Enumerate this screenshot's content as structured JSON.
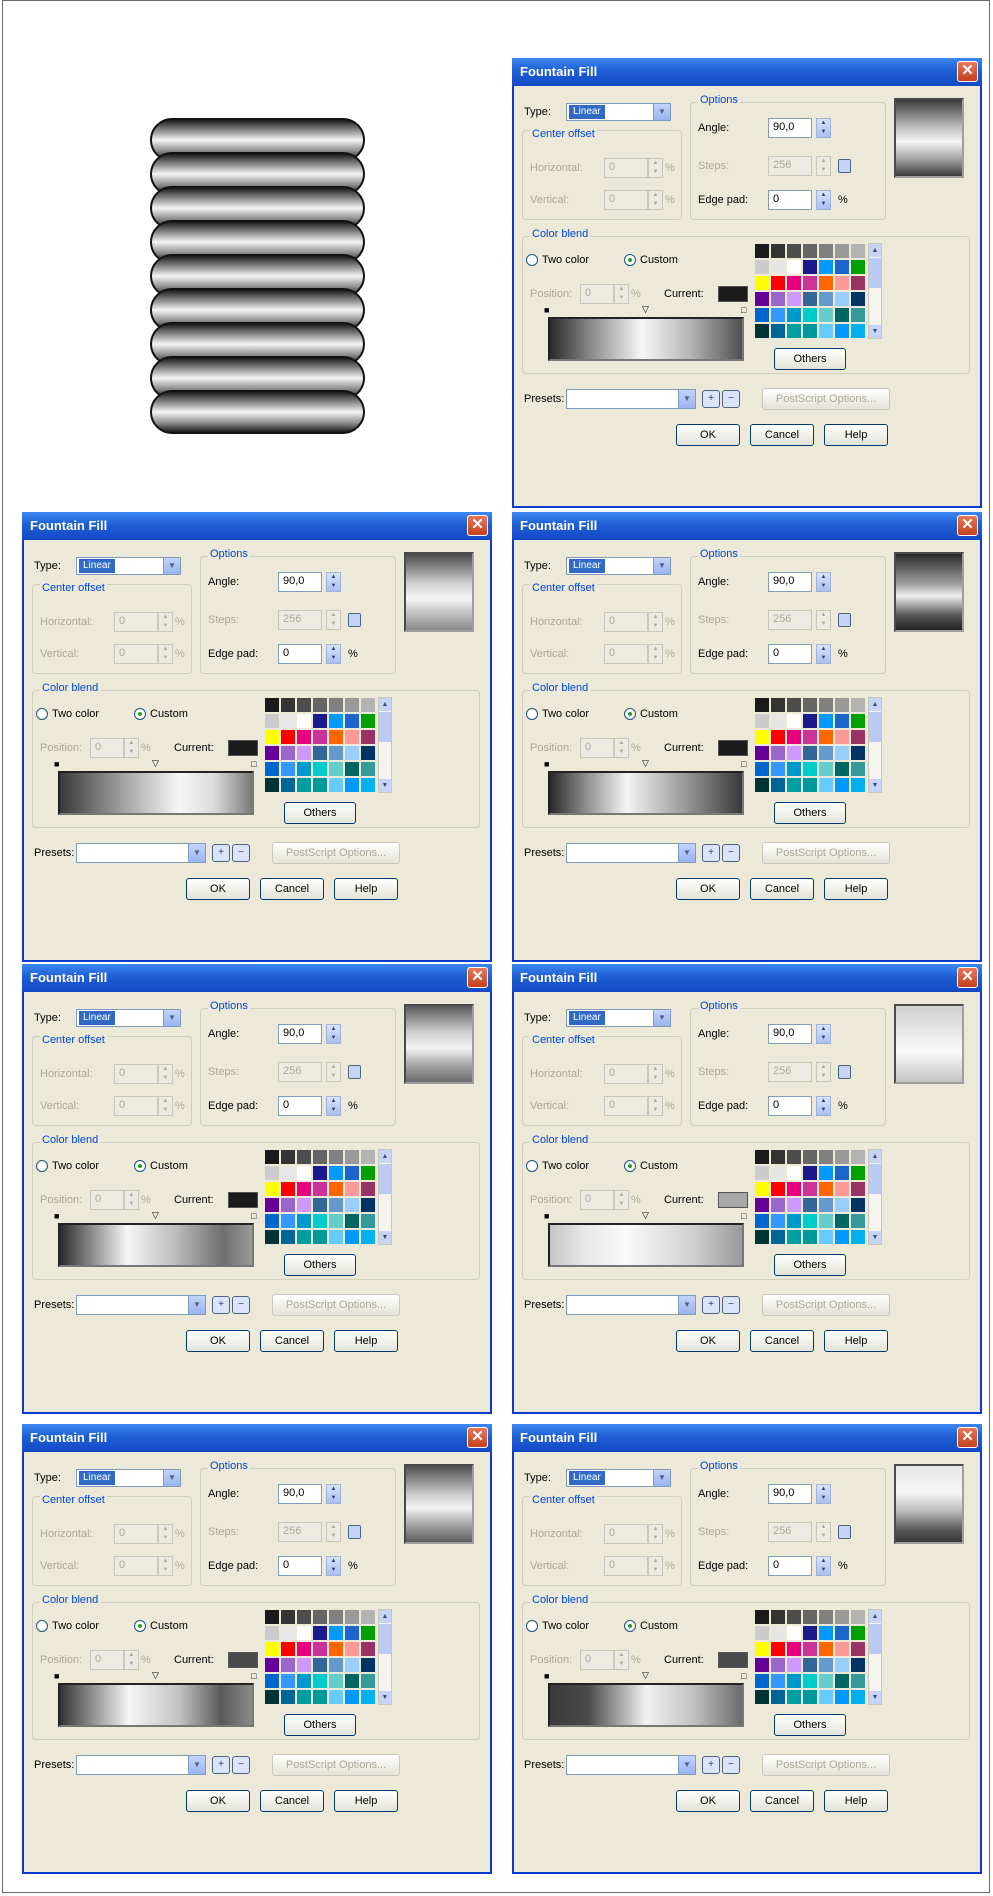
{
  "dialogs": [
    {
      "title": "Fountain Fill",
      "type_label": "Type:",
      "type_value": "Linear",
      "options_label": "Options",
      "angle_label": "Angle:",
      "angle_value": "90,0",
      "steps_label": "Steps:",
      "steps_value": "256",
      "edge_pad_label": "Edge pad:",
      "edge_pad_value": "0",
      "percent": "%",
      "center_offset_label": "Center offset",
      "horizontal_label": "Horizontal:",
      "horizontal_value": "0",
      "vertical_label": "Vertical:",
      "vertical_value": "0",
      "color_blend_label": "Color blend",
      "two_color_label": "Two color",
      "custom_label": "Custom",
      "position_label": "Position:",
      "position_value": "0",
      "current_label": "Current:",
      "current_color": "#1a1a1a",
      "gradient_css": "linear-gradient(to right,#2a2a2a 0%,#9a9a9a 25%,#f7f7f7 48%,#b8b8b8 72%,#505050 100%)",
      "preview_css": "linear-gradient(to bottom,#3c3c3c 0%,#bcbcbc 35%,#f5f5f5 55%,#999999 80%,#3a3a3a 100%)",
      "others_label": "Others",
      "presets_label": "Presets:",
      "postscript_label": "PostScript Options...",
      "ok_label": "OK",
      "cancel_label": "Cancel",
      "help_label": "Help"
    },
    {
      "title": "Fountain Fill",
      "type_label": "Type:",
      "type_value": "Linear",
      "options_label": "Options",
      "angle_label": "Angle:",
      "angle_value": "90,0",
      "steps_label": "Steps:",
      "steps_value": "256",
      "edge_pad_label": "Edge pad:",
      "edge_pad_value": "0",
      "percent": "%",
      "center_offset_label": "Center offset",
      "horizontal_label": "Horizontal:",
      "horizontal_value": "0",
      "vertical_label": "Vertical:",
      "vertical_value": "0",
      "color_blend_label": "Color blend",
      "two_color_label": "Two color",
      "custom_label": "Custom",
      "position_label": "Position:",
      "position_value": "0",
      "current_label": "Current:",
      "current_color": "#1a1a1a",
      "gradient_css": "linear-gradient(to right,#3a3a3a 0%,#a8a8a8 35%,#f6f6f6 62%,#dcdcdc 80%,#7a7a7a 100%)",
      "preview_css": "linear-gradient(to bottom,#4a4a4a 0%,#d5d5d5 40%,#f5f5f5 58%,#8a8a8a 100%)",
      "others_label": "Others",
      "presets_label": "Presets:",
      "postscript_label": "PostScript Options...",
      "ok_label": "OK",
      "cancel_label": "Cancel",
      "help_label": "Help"
    },
    {
      "title": "Fountain Fill",
      "type_label": "Type:",
      "type_value": "Linear",
      "options_label": "Options",
      "angle_label": "Angle:",
      "angle_value": "90,0",
      "steps_label": "Steps:",
      "steps_value": "256",
      "edge_pad_label": "Edge pad:",
      "edge_pad_value": "0",
      "percent": "%",
      "center_offset_label": "Center offset",
      "horizontal_label": "Horizontal:",
      "horizontal_value": "0",
      "vertical_label": "Vertical:",
      "vertical_value": "0",
      "color_blend_label": "Color blend",
      "two_color_label": "Two color",
      "custom_label": "Custom",
      "position_label": "Position:",
      "position_value": "0",
      "current_label": "Current:",
      "current_color": "#1a1a1a",
      "gradient_css": "linear-gradient(to right,#2a2a2a 0%,#8a8a8a 18%,#f4f4f4 40%,#9a9a9a 70%,#3a3a3a 100%)",
      "preview_css": "linear-gradient(to bottom,#2a2a2a 0%,#a0a0a0 40%,#f0f0f0 55%,#5a5a5a 80%,#222222 100%)",
      "others_label": "Others",
      "presets_label": "Presets:",
      "postscript_label": "PostScript Options...",
      "ok_label": "OK",
      "cancel_label": "Cancel",
      "help_label": "Help"
    },
    {
      "title": "Fountain Fill",
      "type_label": "Type:",
      "type_value": "Linear",
      "options_label": "Options",
      "angle_label": "Angle:",
      "angle_value": "90,0",
      "steps_label": "Steps:",
      "steps_value": "256",
      "edge_pad_label": "Edge pad:",
      "edge_pad_value": "0",
      "percent": "%",
      "center_offset_label": "Center offset",
      "horizontal_label": "Horizontal:",
      "horizontal_value": "0",
      "vertical_label": "Vertical:",
      "vertical_value": "0",
      "color_blend_label": "Color blend",
      "two_color_label": "Two color",
      "custom_label": "Custom",
      "position_label": "Position:",
      "position_value": "0",
      "current_label": "Current:",
      "current_color": "#1a1a1a",
      "gradient_css": "linear-gradient(to right,#2a2a2a 0%,#a0a0a0 20%,#f6f6f6 35%,#bdbdbd 60%,#6e6e6e 85%,#9a9a9a 100%)",
      "preview_css": "linear-gradient(to bottom,#5a5a5a 0%,#cfcfcf 35%,#f4f4f4 55%,#9f9f9f 80%,#6c6c6c 100%)",
      "others_label": "Others",
      "presets_label": "Presets:",
      "postscript_label": "PostScript Options...",
      "ok_label": "OK",
      "cancel_label": "Cancel",
      "help_label": "Help"
    },
    {
      "title": "Fountain Fill",
      "type_label": "Type:",
      "type_value": "Linear",
      "options_label": "Options",
      "angle_label": "Angle:",
      "angle_value": "90,0",
      "steps_label": "Steps:",
      "steps_value": "256",
      "edge_pad_label": "Edge pad:",
      "edge_pad_value": "0",
      "percent": "%",
      "center_offset_label": "Center offset",
      "horizontal_label": "Horizontal:",
      "horizontal_value": "0",
      "vertical_label": "Vertical:",
      "vertical_value": "0",
      "color_blend_label": "Color blend",
      "two_color_label": "Two color",
      "custom_label": "Custom",
      "position_label": "Position:",
      "position_value": "0",
      "current_label": "Current:",
      "current_color": "#a9a9a9",
      "gradient_css": "linear-gradient(to right,#c4c4c4 0%,#e8e8e8 18%,#fafafa 40%,#cfcfcf 75%,#9a9a9a 100%)",
      "preview_css": "linear-gradient(to bottom,#d0d0d0 0%,#ececec 40%,#fafafa 60%,#c4c4c4 100%)",
      "others_label": "Others",
      "presets_label": "Presets:",
      "postscript_label": "PostScript Options...",
      "ok_label": "OK",
      "cancel_label": "Cancel",
      "help_label": "Help"
    },
    {
      "title": "Fountain Fill",
      "type_label": "Type:",
      "type_value": "Linear",
      "options_label": "Options",
      "angle_label": "Angle:",
      "angle_value": "90,0",
      "steps_label": "Steps:",
      "steps_value": "256",
      "edge_pad_label": "Edge pad:",
      "edge_pad_value": "0",
      "percent": "%",
      "center_offset_label": "Center offset",
      "horizontal_label": "Horizontal:",
      "horizontal_value": "0",
      "vertical_label": "Vertical:",
      "vertical_value": "0",
      "color_blend_label": "Color blend",
      "two_color_label": "Two color",
      "custom_label": "Custom",
      "position_label": "Position:",
      "position_value": "0",
      "current_label": "Current:",
      "current_color": "#4a4a4a",
      "gradient_css": "linear-gradient(to right,#333333 0%,#a0a0a0 20%,#f6f6f6 36%,#c2c2c2 62%,#5a5a5a 84%,#8a8a8a 100%)",
      "preview_css": "linear-gradient(to bottom,#505050 0%,#cdcdcd 38%,#f4f4f4 55%,#a2a2a2 78%,#5e5e5e 100%)",
      "others_label": "Others",
      "presets_label": "Presets:",
      "postscript_label": "PostScript Options...",
      "ok_label": "OK",
      "cancel_label": "Cancel",
      "help_label": "Help"
    },
    {
      "title": "Fountain Fill",
      "type_label": "Type:",
      "type_value": "Linear",
      "options_label": "Options",
      "angle_label": "Angle:",
      "angle_value": "90,0",
      "steps_label": "Steps:",
      "steps_value": "256",
      "edge_pad_label": "Edge pad:",
      "edge_pad_value": "0",
      "percent": "%",
      "center_offset_label": "Center offset",
      "horizontal_label": "Horizontal:",
      "horizontal_value": "0",
      "vertical_label": "Vertical:",
      "vertical_value": "0",
      "color_blend_label": "Color blend",
      "two_color_label": "Two color",
      "custom_label": "Custom",
      "position_label": "Position:",
      "position_value": "0",
      "current_label": "Current:",
      "current_color": "#4a4a4a",
      "gradient_css": "linear-gradient(to right,#3a3a3a 0%,#4a4a4a 20%,#8e8e8e 32%,#f2f2f2 50%,#c0c0c0 75%,#6a6a6a 100%)",
      "preview_css": "linear-gradient(to bottom,#e6e6e6 0%,#f6f6f6 35%,#b8b8b8 60%,#555555 85%,#3a3a3a 100%)",
      "others_label": "Others",
      "presets_label": "Presets:",
      "postscript_label": "PostScript Options...",
      "ok_label": "OK",
      "cancel_label": "Cancel",
      "help_label": "Help"
    }
  ],
  "palette_colors": [
    "#1a1a1a",
    "#333333",
    "#4d4d4d",
    "#666666",
    "#808080",
    "#999999",
    "#b3b3b3",
    "#cccccc",
    "#e6e6e6",
    "#ffffff",
    "#1a1a8c",
    "#0099ff",
    "#1a66cc",
    "#00a000",
    "#ffff00",
    "#ff0000",
    "#e6007e",
    "#cc3399",
    "#ff6600",
    "#ff9999",
    "#993366",
    "#660099",
    "#9966cc",
    "#cc99ff",
    "#336699",
    "#6699cc",
    "#99ccff",
    "#003366",
    "#0066cc",
    "#3399ff",
    "#0099cc",
    "#00cccc",
    "#66cccc",
    "#006666",
    "#339999",
    "#003333",
    "#006699",
    "#00a0a0",
    "#009999",
    "#66ccff",
    "#0099ff",
    "#00b0f0"
  ]
}
